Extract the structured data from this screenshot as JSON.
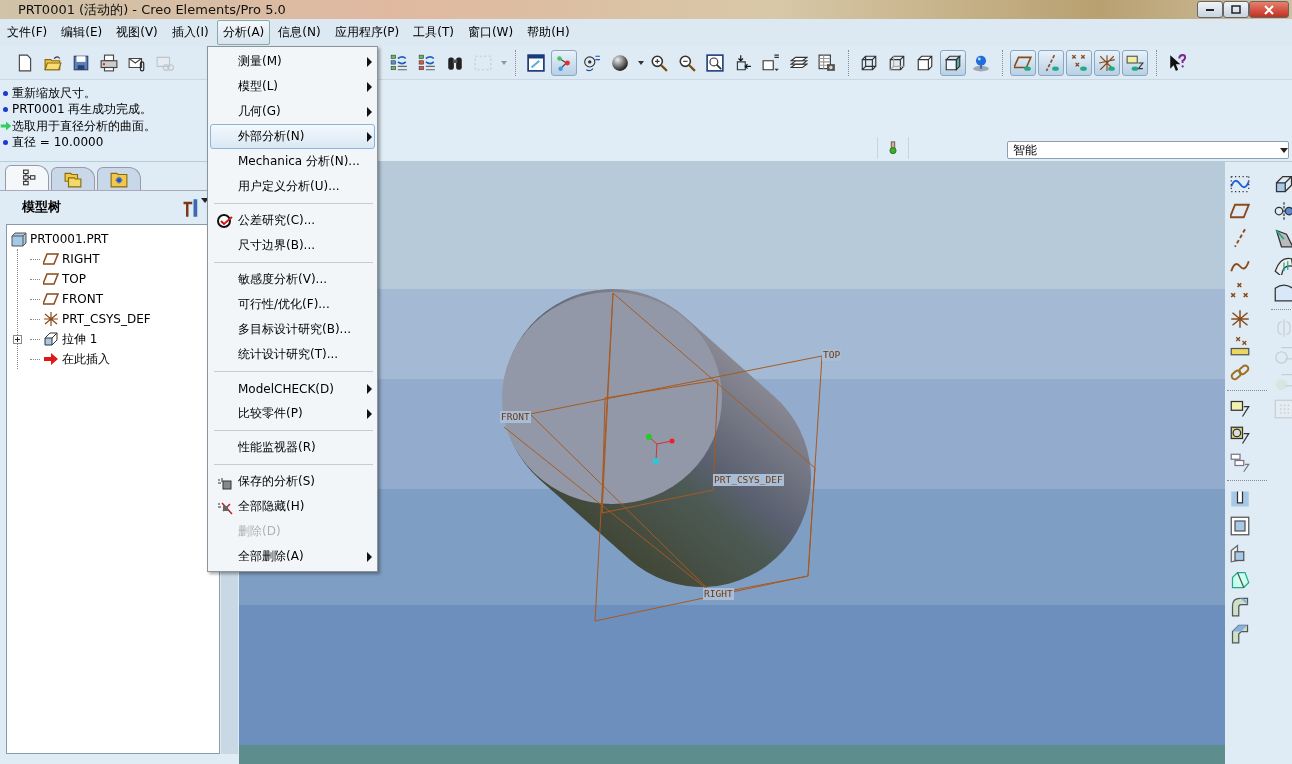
{
  "window": {
    "title": "PRT0001 (活动的) - Creo Elements/Pro 5.0"
  },
  "menu_bar": [
    {
      "label": "文件(F)",
      "selected": false
    },
    {
      "label": "编辑(E)",
      "selected": false
    },
    {
      "label": "视图(V)",
      "selected": false
    },
    {
      "label": "插入(I)",
      "selected": false
    },
    {
      "label": "分析(A)",
      "selected": true
    },
    {
      "label": "信息(N)",
      "selected": false
    },
    {
      "label": "应用程序(P)",
      "selected": false
    },
    {
      "label": "工具(T)",
      "selected": false
    },
    {
      "label": "窗口(W)",
      "selected": false
    },
    {
      "label": "帮助(H)",
      "selected": false
    }
  ],
  "toolbar_groups": [
    [
      {
        "kind": "page",
        "pressed": false,
        "disabled": false
      },
      {
        "kind": "open-folder",
        "pressed": false,
        "disabled": false
      },
      {
        "kind": "floppy-disk",
        "pressed": false,
        "disabled": false
      },
      {
        "kind": "printer",
        "pressed": false,
        "disabled": false
      },
      {
        "kind": "envelope-clip",
        "pressed": false,
        "disabled": false
      },
      {
        "kind": "envelope-link",
        "pressed": false,
        "disabled": true
      }
    ],
    [
      {
        "kind": "tree-refresh",
        "pressed": false,
        "disabled": false
      },
      {
        "kind": "tree-update",
        "pressed": false,
        "disabled": false
      },
      {
        "kind": "binoculars",
        "pressed": false,
        "disabled": false
      },
      {
        "kind": "dashed-box",
        "pressed": false,
        "disabled": true
      },
      {
        "kind": "caret",
        "pressed": false,
        "disabled": true
      }
    ],
    [
      {
        "kind": "repaint-window",
        "pressed": false,
        "disabled": false
      },
      {
        "kind": "node-link",
        "pressed": true,
        "disabled": false
      },
      {
        "kind": "orient-dial",
        "pressed": false,
        "disabled": false
      },
      {
        "kind": "shading-sphere",
        "pressed": false,
        "disabled": false
      },
      {
        "kind": "caret",
        "pressed": false,
        "disabled": false
      },
      {
        "kind": "zoom-in",
        "pressed": false,
        "disabled": false
      },
      {
        "kind": "zoom-out",
        "pressed": false,
        "disabled": false
      },
      {
        "kind": "zoom-fit",
        "pressed": false,
        "disabled": false
      },
      {
        "kind": "box-arrow",
        "pressed": false,
        "disabled": false
      },
      {
        "kind": "view-box",
        "pressed": false,
        "disabled": false
      },
      {
        "kind": "layers",
        "pressed": false,
        "disabled": false
      },
      {
        "kind": "table-camera",
        "pressed": false,
        "disabled": false
      }
    ],
    [
      {
        "kind": "cube-wire",
        "pressed": false,
        "disabled": false
      },
      {
        "kind": "cube-hidden",
        "pressed": false,
        "disabled": false
      },
      {
        "kind": "cube-plain",
        "pressed": false,
        "disabled": false
      },
      {
        "kind": "cube-shaded",
        "pressed": true,
        "disabled": false
      },
      {
        "kind": "sphere-pin",
        "pressed": false,
        "disabled": false
      }
    ],
    [
      {
        "kind": "plane-eye",
        "pressed": true,
        "disabled": false
      },
      {
        "kind": "axis-eye",
        "pressed": true,
        "disabled": false
      },
      {
        "kind": "points-eye",
        "pressed": true,
        "disabled": false
      },
      {
        "kind": "csys-eye",
        "pressed": true,
        "disabled": false
      },
      {
        "kind": "note-eye",
        "pressed": true,
        "disabled": false
      }
    ],
    [
      {
        "kind": "help-cursor",
        "pressed": false,
        "disabled": false
      }
    ]
  ],
  "messages": [
    {
      "kind": "info",
      "text": "重新缩放尺寸。"
    },
    {
      "kind": "info",
      "text": "PRT0001 再生成功完成。"
    },
    {
      "kind": "prompt",
      "text": "选取用于直径分析的曲面。"
    },
    {
      "kind": "info",
      "text": "直径 = 10.0000"
    }
  ],
  "filter": {
    "value": "智能"
  },
  "model_tree": {
    "tabs": [
      {
        "kind": "tree-nodes",
        "selected": true
      },
      {
        "kind": "folders",
        "selected": false
      },
      {
        "kind": "star-folder",
        "selected": false
      }
    ],
    "title": "模型树",
    "items": [
      {
        "label": "PRT0001.PRT",
        "kind": "part",
        "collapsed": false,
        "children": [
          {
            "label": "RIGHT",
            "kind": "plane",
            "collapsed": false
          },
          {
            "label": "TOP",
            "kind": "plane",
            "collapsed": false
          },
          {
            "label": "FRONT",
            "kind": "plane",
            "collapsed": false
          },
          {
            "label": "PRT_CSYS_DEF",
            "kind": "csys",
            "collapsed": false
          },
          {
            "label": "拉伸 1",
            "kind": "extrude",
            "collapsed": true
          },
          {
            "label": "在此插入",
            "kind": "insert-arrow",
            "collapsed": false
          }
        ]
      }
    ]
  },
  "datum_labels": [
    {
      "text": "FRONT"
    },
    {
      "text": "TOP"
    },
    {
      "text": "RIGHT"
    },
    {
      "text": "PRT_CSYS_DEF"
    }
  ],
  "right_toolbar": {
    "column_1": [
      [
        {
          "kind": "sketch-curve",
          "disabled": false
        },
        {
          "kind": "plane",
          "disabled": false
        },
        {
          "kind": "axis",
          "disabled": false
        },
        {
          "kind": "curve",
          "disabled": false
        },
        {
          "kind": "points",
          "disabled": false
        },
        {
          "kind": "csys",
          "disabled": false
        },
        {
          "kind": "points-grid",
          "disabled": false
        },
        {
          "kind": "chain",
          "disabled": false
        }
      ],
      [
        {
          "kind": "note-box",
          "disabled": false
        },
        {
          "kind": "note-circle",
          "disabled": false
        },
        {
          "kind": "note-boxes",
          "disabled": false
        }
      ],
      [
        {
          "kind": "hole",
          "disabled": false
        },
        {
          "kind": "shell",
          "disabled": false
        },
        {
          "kind": "rib",
          "disabled": false
        },
        {
          "kind": "draft",
          "disabled": false
        },
        {
          "kind": "round",
          "disabled": false
        },
        {
          "kind": "chamfer",
          "disabled": false
        }
      ]
    ],
    "column_2": [
      [
        {
          "kind": "extrude",
          "disabled": false
        },
        {
          "kind": "revolve",
          "disabled": false
        },
        {
          "kind": "sweep",
          "disabled": false
        },
        {
          "kind": "blend",
          "disabled": false
        },
        {
          "kind": "boundary",
          "disabled": false
        }
      ],
      [
        {
          "kind": "mirror",
          "disabled": true
        },
        {
          "kind": "merge",
          "disabled": true
        },
        {
          "kind": "trim",
          "disabled": true
        },
        {
          "kind": "pattern",
          "disabled": true
        }
      ]
    ]
  },
  "analysis_menu": [
    [
      {
        "label": "测量(M)",
        "kind": "text",
        "submenu": true,
        "selected": false,
        "disabled": false
      },
      {
        "label": "模型(L)",
        "kind": "text",
        "submenu": true,
        "selected": false,
        "disabled": false
      },
      {
        "label": "几何(G)",
        "kind": "text",
        "submenu": true,
        "selected": false,
        "disabled": false
      },
      {
        "label": "外部分析(N)",
        "kind": "text",
        "submenu": true,
        "selected": true,
        "disabled": false
      },
      {
        "label": "Mechanica 分析(N)...",
        "kind": "text",
        "submenu": false,
        "selected": false,
        "disabled": false
      },
      {
        "label": "用户定义分析(U)...",
        "kind": "text",
        "submenu": false,
        "selected": false,
        "disabled": false
      }
    ],
    [
      {
        "label": "公差研究(C)...",
        "kind": "tolerance",
        "submenu": false,
        "selected": false,
        "disabled": false
      },
      {
        "label": "尺寸边界(B)...",
        "kind": "text",
        "submenu": false,
        "selected": false,
        "disabled": false
      }
    ],
    [
      {
        "label": "敏感度分析(V)...",
        "kind": "text",
        "submenu": false,
        "selected": false,
        "disabled": false
      },
      {
        "label": "可行性/优化(F)...",
        "kind": "text",
        "submenu": false,
        "selected": false,
        "disabled": false
      },
      {
        "label": "多目标设计研究(B)...",
        "kind": "text",
        "submenu": false,
        "selected": false,
        "disabled": false
      },
      {
        "label": "统计设计研究(T)...",
        "kind": "text",
        "submenu": false,
        "selected": false,
        "disabled": false
      }
    ],
    [
      {
        "label": "ModelCHECK(D)",
        "kind": "text",
        "submenu": true,
        "selected": false,
        "disabled": false
      },
      {
        "label": "比较零件(P)",
        "kind": "text",
        "submenu": true,
        "selected": false,
        "disabled": false
      }
    ],
    [
      {
        "label": "性能监视器(R)",
        "kind": "text",
        "submenu": false,
        "selected": false,
        "disabled": false
      }
    ],
    [
      {
        "label": "保存的分析(S)",
        "kind": "saved",
        "submenu": false,
        "selected": false,
        "disabled": false
      },
      {
        "label": "全部隐藏(H)",
        "kind": "hide",
        "submenu": false,
        "selected": false,
        "disabled": false
      },
      {
        "label": "删除(D)",
        "kind": "text",
        "submenu": false,
        "selected": false,
        "disabled": true
      },
      {
        "label": "全部删除(A)",
        "kind": "text",
        "submenu": true,
        "selected": false,
        "disabled": false
      }
    ]
  ]
}
